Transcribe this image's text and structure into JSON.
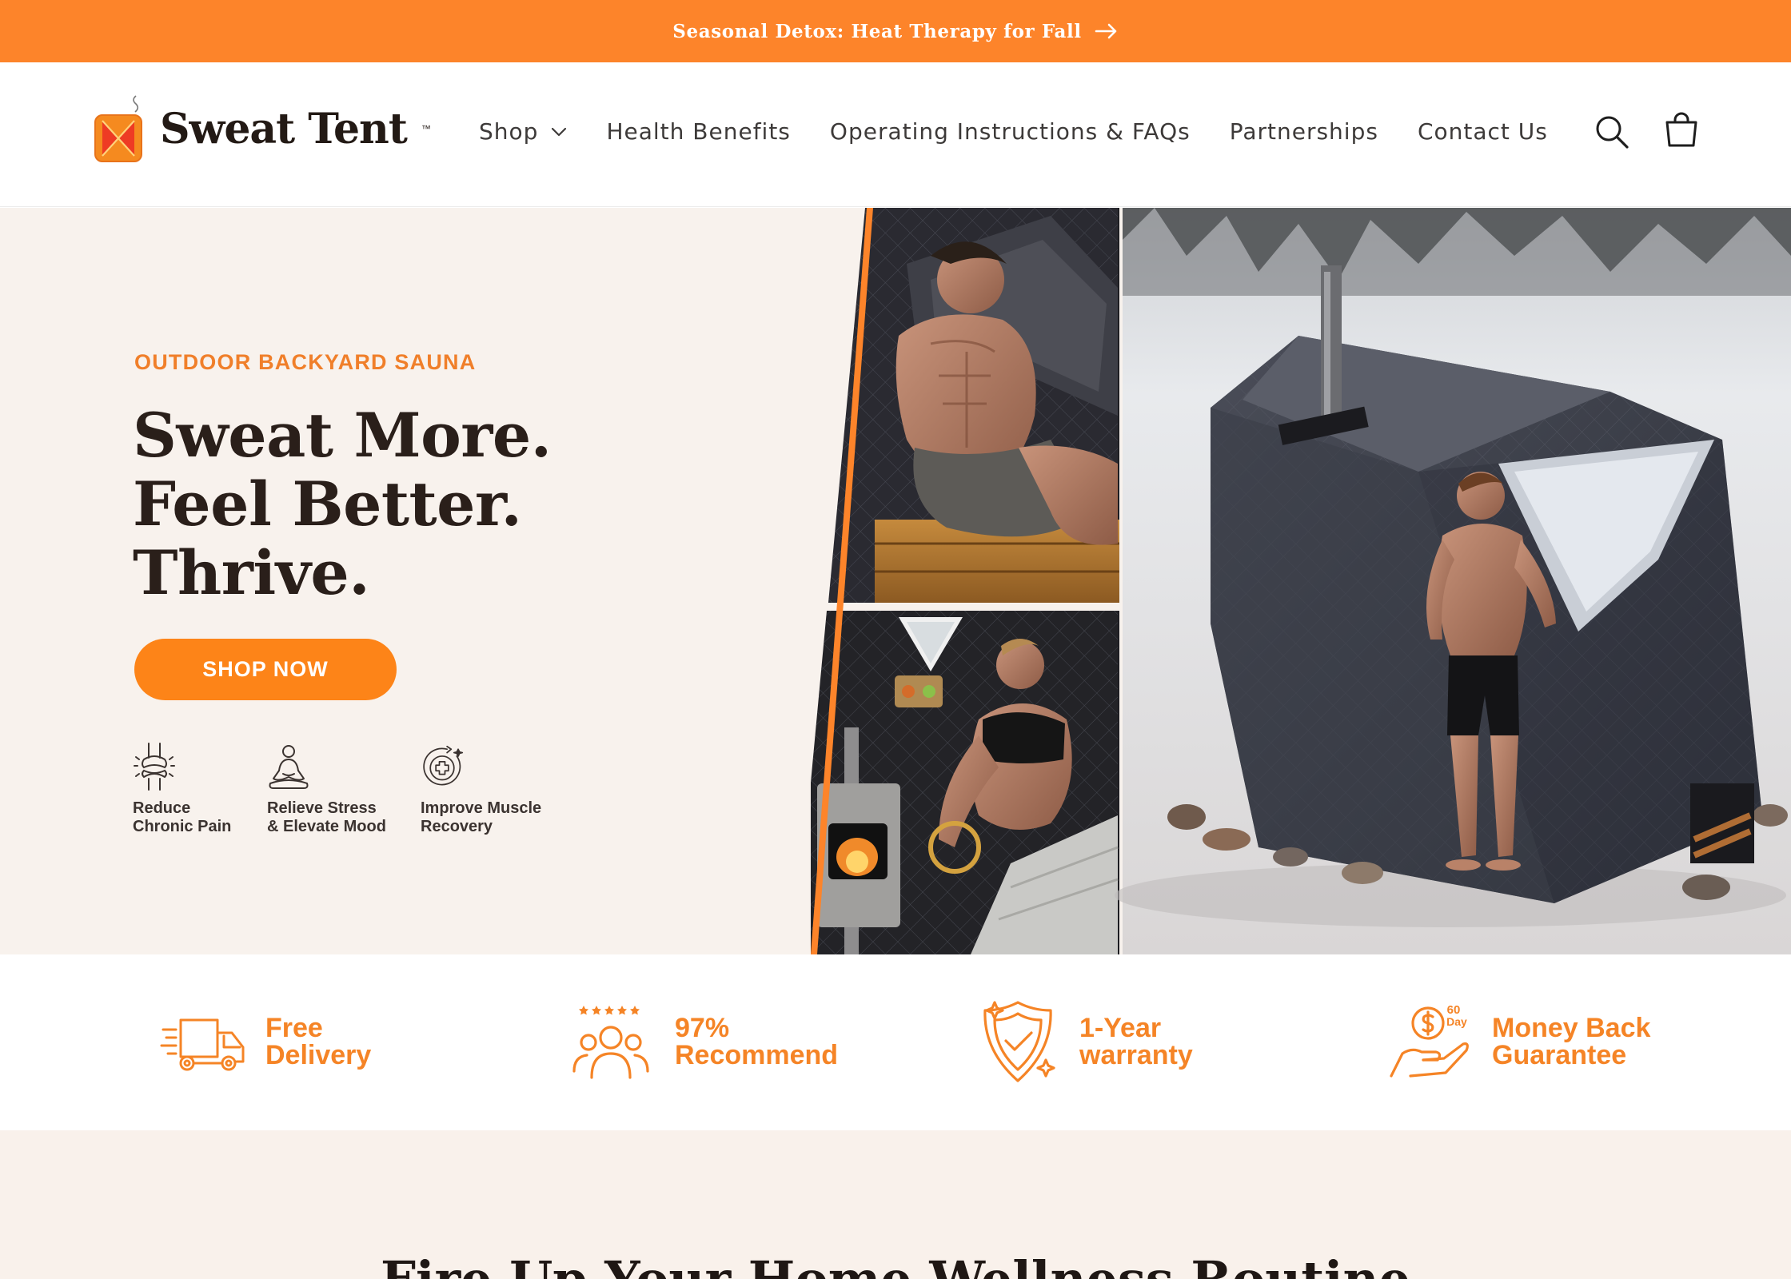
{
  "announcement": {
    "text": "Seasonal Detox: Heat Therapy for Fall"
  },
  "header": {
    "logo_text": "Sweat Tent",
    "nav": [
      "Shop",
      "Health Benefits",
      "Operating Instructions & FAQs",
      "Partnerships",
      "Contact Us"
    ],
    "icons": [
      "search-icon",
      "cart-icon"
    ]
  },
  "hero": {
    "eyebrow": "OUTDOOR BACKYARD SAUNA",
    "headline": [
      "Sweat More.",
      "Feel Better.",
      "Thrive."
    ],
    "cta": "SHOP NOW",
    "benefits": [
      {
        "label": "Reduce\nChronic Pain",
        "icon": "joint-icon"
      },
      {
        "label": "Relieve Stress\n& Elevate Mood",
        "icon": "meditation-icon"
      },
      {
        "label": "Improve Muscle\nRecovery",
        "icon": "muscle-recovery-icon"
      }
    ]
  },
  "features": [
    {
      "label": "Free\nDelivery",
      "icon": "delivery-truck-icon"
    },
    {
      "label": "97%\nRecommend",
      "icon": "people-icon"
    },
    {
      "label": "1-Year\nwarranty",
      "icon": "shield-check-icon"
    },
    {
      "label": "Money Back\nGuarantee",
      "icon": "money-hand-icon"
    }
  ],
  "section": {
    "title": "Fire Up Your Home Wellness Routine"
  },
  "colors": {
    "accent": "#fd842a",
    "hero_bg": "#f8f2ed",
    "text_dark": "#2a1f1a"
  }
}
